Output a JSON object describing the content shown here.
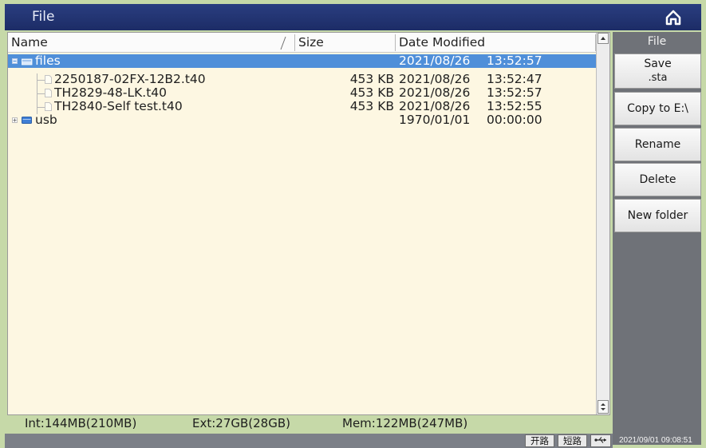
{
  "window": {
    "title": "File"
  },
  "columns": {
    "name": "Name",
    "size": "Size",
    "date": "Date Modified"
  },
  "rows": [
    {
      "name": "files",
      "size": "",
      "date": "2021/08/26",
      "time": "13:52:57",
      "selected": true
    },
    {
      "name": "2250187-02FX-12B2.t40",
      "size": "453 KB",
      "date": "2021/08/26",
      "time": "13:52:47"
    },
    {
      "name": "TH2829-48-LK.t40",
      "size": "453 KB",
      "date": "2021/08/26",
      "time": "13:52:57"
    },
    {
      "name": "TH2840-Self test.t40",
      "size": "453 KB",
      "date": "2021/08/26",
      "time": "13:52:55"
    },
    {
      "name": "usb",
      "size": "",
      "date": "1970/01/01",
      "time": "00:00:00"
    }
  ],
  "sidebar": {
    "title": "File",
    "save_line1": "Save",
    "save_line2": ".sta",
    "copy": "Copy to E:\\",
    "rename": "Rename",
    "delete": "Delete",
    "new_folder": "New folder"
  },
  "status": {
    "internal": "Int:144MB(210MB)",
    "external": "Ext:27GB(28GB)",
    "memory": "Mem:122MB(247MB)"
  },
  "bottom": {
    "open": "开路",
    "short": "短路",
    "clock": "2021/09/01 09:08:51"
  },
  "colors": {
    "titlebar": "#22347a",
    "selection": "#4f8fd9",
    "list_background": "#fdf7e2",
    "outer_background": "#c6d9a8",
    "sidebar": "#6f7278"
  }
}
